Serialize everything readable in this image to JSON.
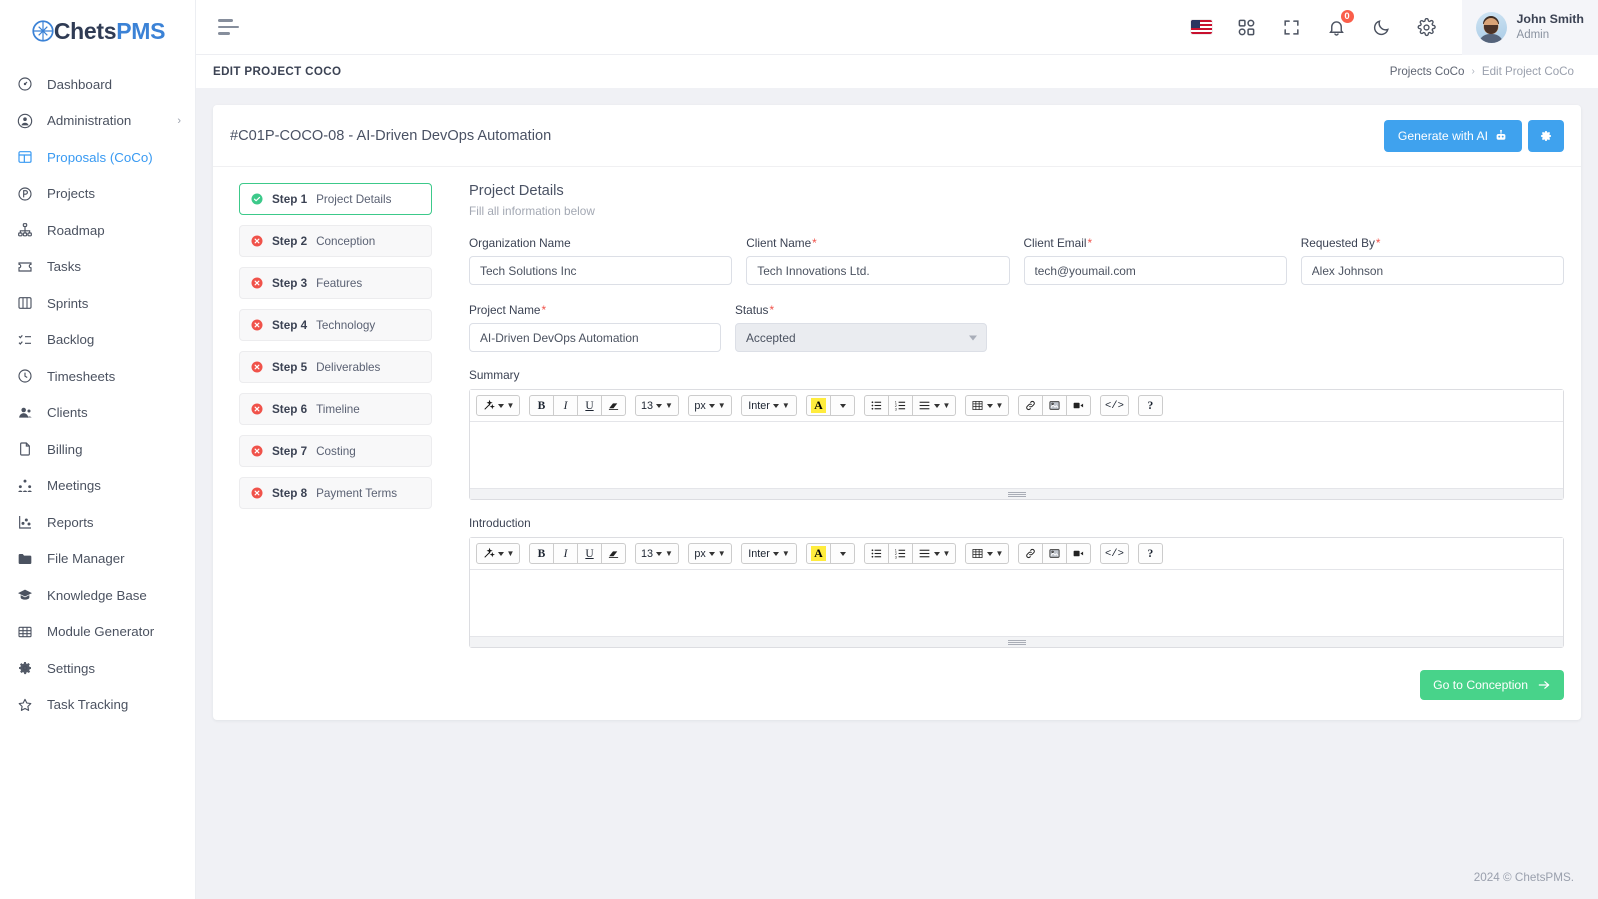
{
  "brand": {
    "name_dark": "Chets",
    "name_blue": "PMS",
    "logo_icon": "compass-logo-icon"
  },
  "sidebar": {
    "items": [
      {
        "label": "Dashboard",
        "icon": "gauge-icon",
        "active": false,
        "has_caret": false
      },
      {
        "label": "Administration",
        "icon": "user-circle-icon",
        "active": false,
        "has_caret": true
      },
      {
        "label": "Proposals (CoCo)",
        "icon": "layout-panel-icon",
        "active": true,
        "has_caret": false
      },
      {
        "label": "Projects",
        "icon": "circle-p-icon",
        "active": false,
        "has_caret": false
      },
      {
        "label": "Roadmap",
        "icon": "hierarchy-icon",
        "active": false,
        "has_caret": false
      },
      {
        "label": "Tasks",
        "icon": "ticket-icon",
        "active": false,
        "has_caret": false
      },
      {
        "label": "Sprints",
        "icon": "kanban-icon",
        "active": false,
        "has_caret": false
      },
      {
        "label": "Backlog",
        "icon": "list-check-icon",
        "active": false,
        "has_caret": false
      },
      {
        "label": "Timesheets",
        "icon": "clock-icon",
        "active": false,
        "has_caret": false
      },
      {
        "label": "Clients",
        "icon": "user-group-icon",
        "active": false,
        "has_caret": false
      },
      {
        "label": "Billing",
        "icon": "file-icon",
        "active": false,
        "has_caret": false
      },
      {
        "label": "Meetings",
        "icon": "people-network-icon",
        "active": false,
        "has_caret": false
      },
      {
        "label": "Reports",
        "icon": "chart-scatter-icon",
        "active": false,
        "has_caret": false
      },
      {
        "label": "File Manager",
        "icon": "folder-icon",
        "active": false,
        "has_caret": false
      },
      {
        "label": "Knowledge Base",
        "icon": "graduation-cap-icon",
        "active": false,
        "has_caret": false
      },
      {
        "label": "Module Generator",
        "icon": "grid-table-icon",
        "active": false,
        "has_caret": false
      },
      {
        "label": "Settings",
        "icon": "gear-icon",
        "active": false,
        "has_caret": false
      },
      {
        "label": "Task Tracking",
        "icon": "star-icon",
        "active": false,
        "has_caret": false
      }
    ]
  },
  "topbar": {
    "menu_icon": "hamburger-icon",
    "language_flag": "us-flag-icon",
    "apps_icon": "apps-grid-icon",
    "fullscreen_icon": "fullscreen-icon",
    "notifications_icon": "bell-icon",
    "notifications_count": "0",
    "dark_mode_icon": "moon-icon",
    "settings_icon": "gear-icon",
    "user": {
      "name": "John Smith",
      "role": "Admin",
      "avatar": "user-avatar"
    }
  },
  "pagehead": {
    "title": "EDIT PROJECT COCO",
    "breadcrumb": {
      "parent": "Projects CoCo",
      "separator": "›",
      "current": "Edit Project CoCo"
    }
  },
  "card": {
    "title": "#C01P-COCO-08 - AI-Driven DevOps Automation",
    "generate_button": "Generate with AI",
    "generate_icon": "robot-icon",
    "settings_button_icon": "gear-icon"
  },
  "steps": [
    {
      "n": "Step 1",
      "label": "Project Details",
      "state": "complete",
      "active": true
    },
    {
      "n": "Step 2",
      "label": "Conception",
      "state": "incomplete",
      "active": false
    },
    {
      "n": "Step 3",
      "label": "Features",
      "state": "incomplete",
      "active": false
    },
    {
      "n": "Step 4",
      "label": "Technology",
      "state": "incomplete",
      "active": false
    },
    {
      "n": "Step 5",
      "label": "Deliverables",
      "state": "incomplete",
      "active": false
    },
    {
      "n": "Step 6",
      "label": "Timeline",
      "state": "incomplete",
      "active": false
    },
    {
      "n": "Step 7",
      "label": "Costing",
      "state": "incomplete",
      "active": false
    },
    {
      "n": "Step 8",
      "label": "Payment Terms",
      "state": "incomplete",
      "active": false
    }
  ],
  "form": {
    "section_title": "Project Details",
    "section_subtitle": "Fill all information below",
    "organization_name": {
      "label": "Organization Name",
      "value": "Tech Solutions Inc",
      "required": false
    },
    "client_name": {
      "label": "Client Name",
      "value": "Tech Innovations Ltd.",
      "required": true
    },
    "client_email": {
      "label": "Client Email",
      "value": "tech@youmail.com",
      "required": true
    },
    "requested_by": {
      "label": "Requested By",
      "value": "Alex Johnson",
      "required": true
    },
    "project_name": {
      "label": "Project Name",
      "value": "AI-Driven DevOps Automation",
      "required": true
    },
    "status": {
      "label": "Status",
      "value": "Accepted",
      "required": true
    },
    "summary": {
      "label": "Summary",
      "value": ""
    },
    "introduction": {
      "label": "Introduction",
      "value": ""
    }
  },
  "editor_toolbar": {
    "font_size": "13",
    "unit": "px",
    "font_family": "Inter",
    "buttons": {
      "style": "magic-wand-icon",
      "bold": "B",
      "italic": "I",
      "underline": "U",
      "clear_format": "eraser-icon",
      "highlight": "A",
      "bullet_list": "bullet-list-icon",
      "numbered_list": "numbered-list-icon",
      "align": "align-icon",
      "table": "table-icon",
      "link": "link-icon",
      "image": "image-icon",
      "video": "video-icon",
      "code": "</>",
      "help": "?"
    }
  },
  "footer_action": {
    "label": "Go to Conception",
    "icon": "arrow-right-icon"
  },
  "footer": {
    "copyright": "2024 © ChetsPMS."
  },
  "colors": {
    "accent_blue": "#3fa2ee",
    "success_green": "#48d38a",
    "step_complete": "#3cc98a",
    "step_incomplete": "#f0524a",
    "sidebar_active": "#399af2",
    "required_red": "#f0524a"
  }
}
